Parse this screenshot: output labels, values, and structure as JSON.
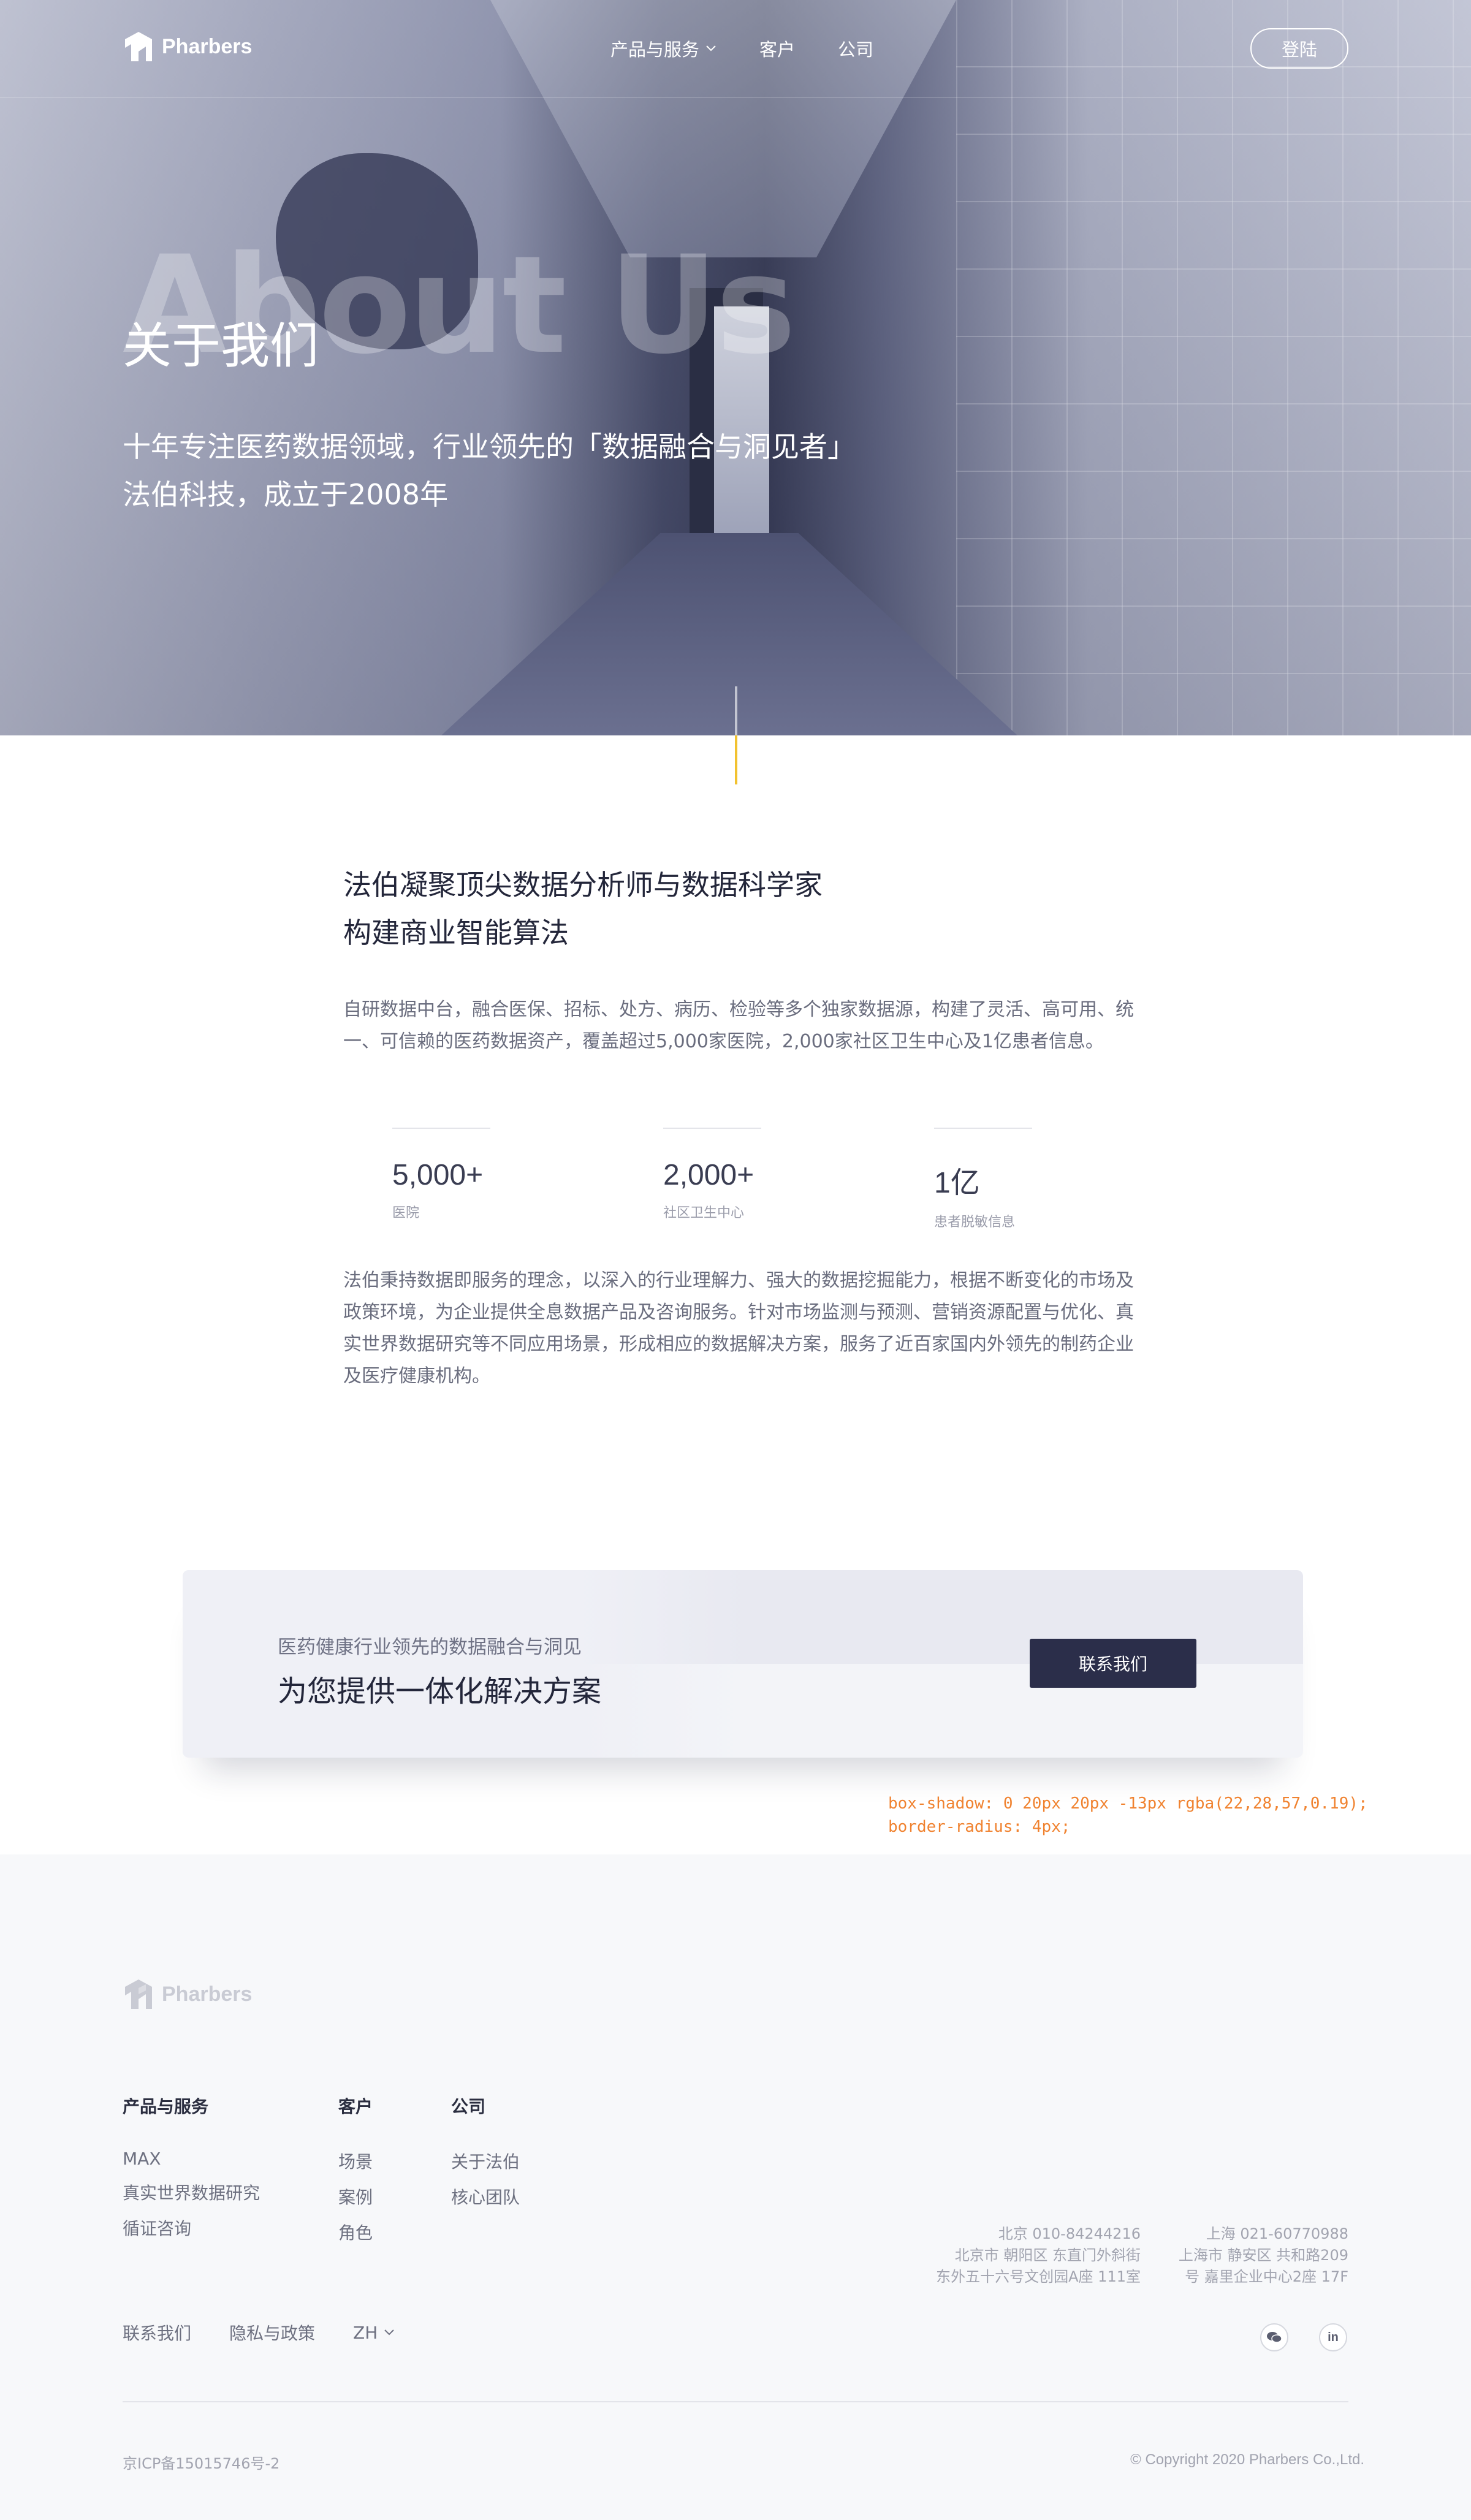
{
  "brand": {
    "name": "Pharbers"
  },
  "nav": {
    "items": [
      {
        "label": "产品与服务",
        "has_dropdown": true
      },
      {
        "label": "客户",
        "has_dropdown": false
      },
      {
        "label": "公司",
        "has_dropdown": false
      }
    ],
    "login_label": "登陆"
  },
  "hero": {
    "background_text": "About Us",
    "title": "关于我们",
    "subtitle_line1": "十年专注医药数据领域，行业领先的「数据融合与洞见者」",
    "subtitle_line2": "法伯科技，成立于2008年"
  },
  "about": {
    "heading_line1": "法伯凝聚顶尖数据分析师与数据科学家",
    "heading_line2": "构建商业智能算法",
    "paragraph1": "自研数据中台，融合医保、招标、处方、病历、检验等多个独家数据源，构建了灵活、高可用、统一、可信赖的医药数据资产，覆盖超过5,000家医院，2,000家社区卫生中心及1亿患者信息。",
    "stats": [
      {
        "value": "5,000+",
        "label": "医院"
      },
      {
        "value": "2,000+",
        "label": "社区卫生中心"
      },
      {
        "value": "1亿",
        "label": "患者脱敏信息"
      }
    ],
    "paragraph2": "法伯秉持数据即服务的理念，以深入的行业理解力、强大的数据挖掘能力，根据不断变化的市场及政策环境，为企业提供全息数据产品及咨询服务。针对市场监测与预测、营销资源配置与优化、真实世界数据研究等不同应用场景，形成相应的数据解决方案，服务了近百家国内外领先的制药企业及医疗健康机构。"
  },
  "cta": {
    "small_text": "医药健康行业领先的数据融合与洞见",
    "big_text": "为您提供一体化解决方案",
    "button_label": "联系我们"
  },
  "annotation": {
    "line1": "box-shadow: 0 20px 20px -13px rgba(22,28,57,0.19);",
    "line2": "border-radius: 4px;"
  },
  "footer": {
    "columns": [
      {
        "heading": "产品与服务",
        "items": [
          "MAX",
          "真实世界数据研究",
          "循证咨询"
        ]
      },
      {
        "heading": "客户",
        "items": [
          "场景",
          "案例",
          "角色"
        ]
      },
      {
        "heading": "公司",
        "items": [
          "关于法伯",
          "核心团队"
        ]
      }
    ],
    "offices": [
      {
        "line1": "北京  010-84244216",
        "line2": "北京市 朝阳区 东直门外斜街",
        "line3": "东外五十六号文创园A座 111室"
      },
      {
        "line1": "上海  021-60770988",
        "line2": "上海市 静安区 共和路209",
        "line3": "号 嘉里企业中心2座 17F"
      }
    ],
    "bottom_links": {
      "contact": "联系我们",
      "privacy": "隐私与政策",
      "lang": "ZH"
    },
    "social": [
      "wechat-icon",
      "linkedin-icon"
    ],
    "linkedin_text": "in",
    "icp": "京ICP备15015746号-2",
    "copyright": "© Copyright 2020 Pharbers Co.,Ltd."
  },
  "colors": {
    "accent_yellow": "#f2c230",
    "dark_button": "#2b2e4a",
    "annotation_orange": "#f0822f"
  }
}
